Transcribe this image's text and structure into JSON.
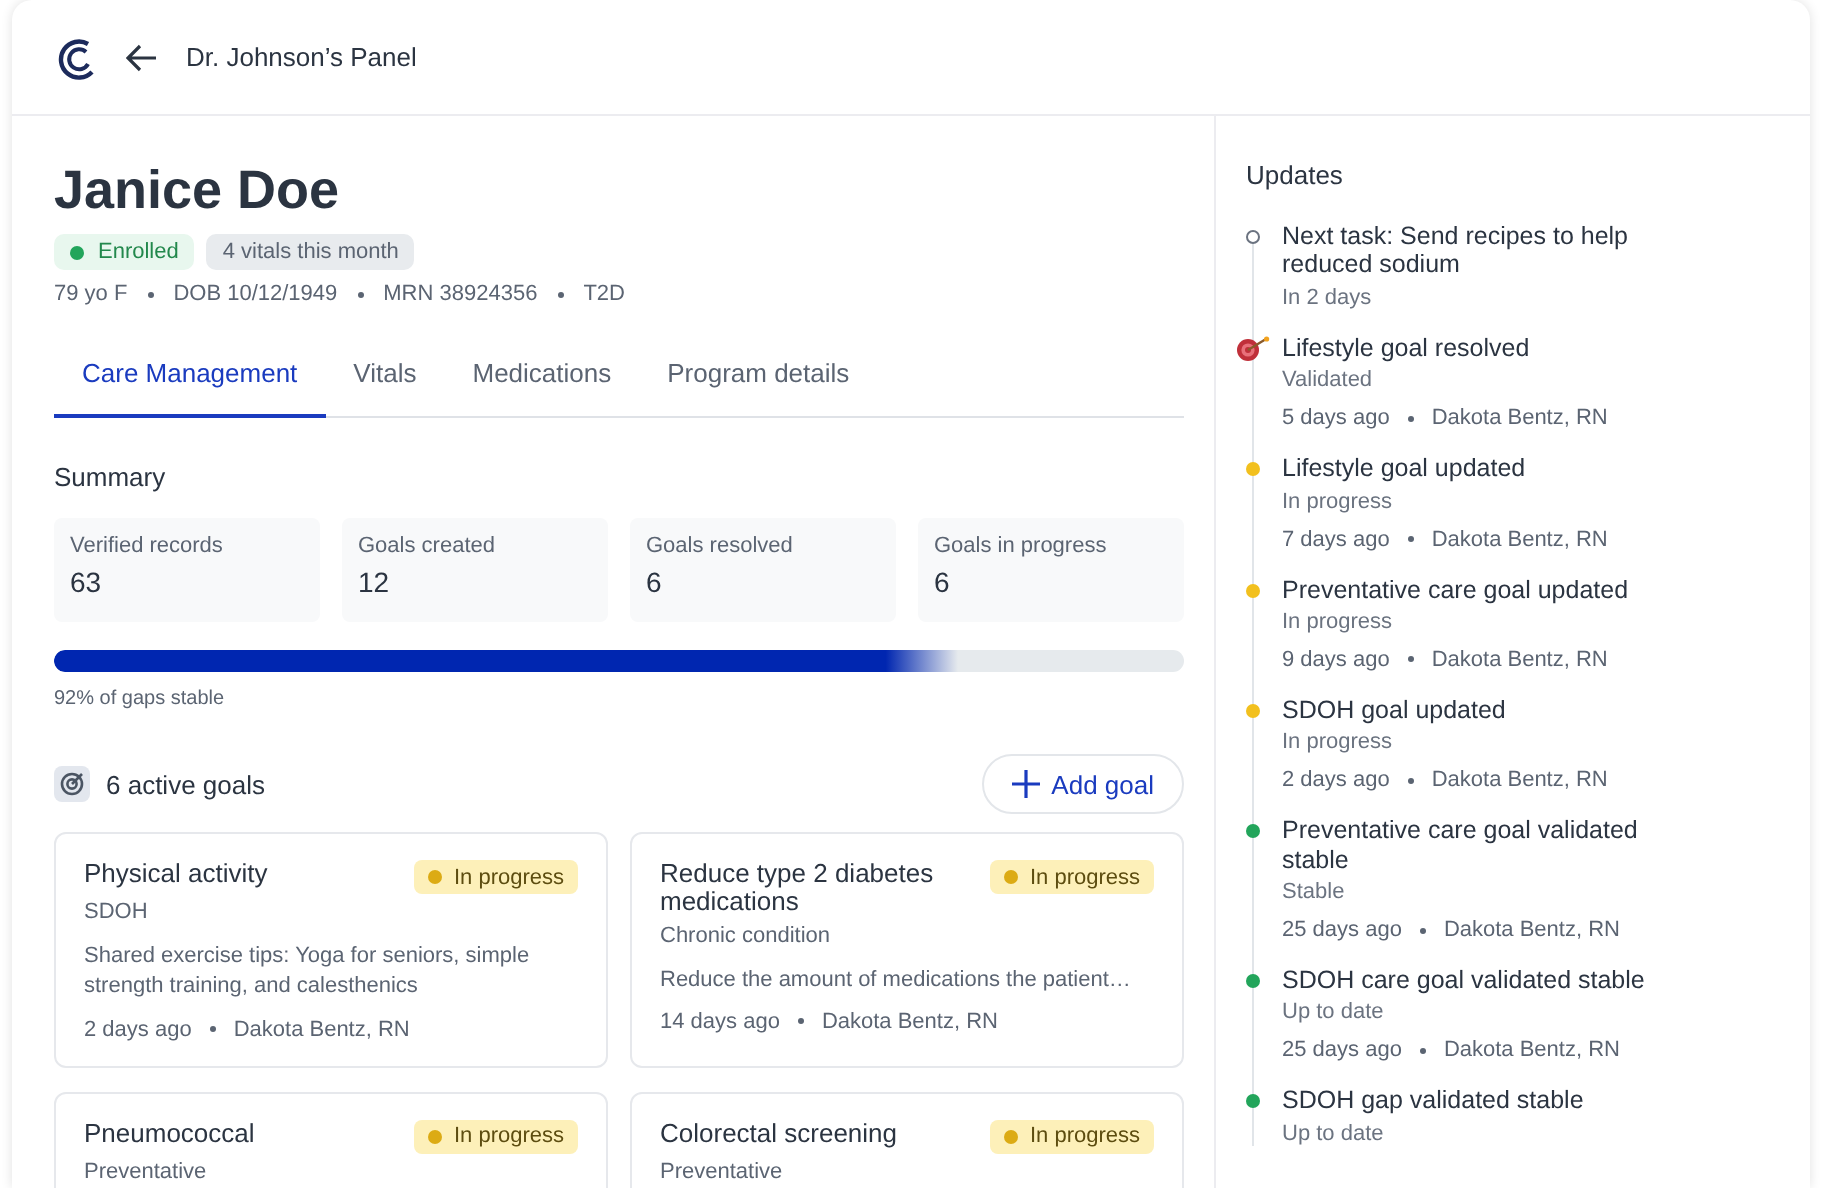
{
  "header": {
    "back_label": "Dr. Johnson’s Panel"
  },
  "patient": {
    "name": "Janice Doe",
    "badges": [
      {
        "kind": "status",
        "label": "Enrolled",
        "color": "#22a55b"
      },
      {
        "kind": "plain",
        "label": "4 vitals this month"
      }
    ],
    "details": [
      "79 yo F",
      "DOB 10/12/1949",
      "MRN 38924356",
      "T2D"
    ]
  },
  "tabs": [
    {
      "label": "Care Management",
      "selected": true
    },
    {
      "label": "Vitals",
      "selected": false
    },
    {
      "label": "Medications",
      "selected": false
    },
    {
      "label": "Program details",
      "selected": false
    }
  ],
  "summary": {
    "title": "Summary",
    "stats": [
      {
        "label": "Verified records",
        "value": "63"
      },
      {
        "label": "Goals created",
        "value": "12"
      },
      {
        "label": "Goals resolved",
        "value": "6"
      },
      {
        "label": "Goals in progress",
        "value": "6"
      }
    ],
    "progress": {
      "level": 0.8,
      "reading": "92% of gaps stable"
    }
  },
  "goals": {
    "title": "6 active goals",
    "add_button": "Add goal",
    "items": [
      {
        "title": "Physical activity",
        "category": "SDOH",
        "status": "In progress",
        "description": "Shared exercise tips: Yoga for seniors, simple strength training, and calesthenics",
        "time": "2 days ago",
        "author": "Dakota Bentz, RN"
      },
      {
        "title": "Reduce type 2 diabetes medications",
        "category": "Chronic condition",
        "status": "In progress",
        "description": "Reduce the amount of medications the patient…",
        "time": "14 days ago",
        "author": "Dakota Bentz, RN"
      },
      {
        "title": "Pneumococcal",
        "category": "Preventative",
        "status": "In progress"
      },
      {
        "title": "Colorectal screening",
        "category": "Preventative",
        "status": "In progress"
      }
    ]
  },
  "updates": {
    "title": "Updates",
    "items": [
      {
        "kind": "pending",
        "title": "Next task: Send recipes to help reduced sodium",
        "status": "In 2 days"
      },
      {
        "kind": "target",
        "title": "Lifestyle goal resolved",
        "status": "Validated",
        "time": "5 days ago",
        "author": "Dakota Bentz, RN"
      },
      {
        "kind": "dot",
        "color": "#f2c01e",
        "title": "Lifestyle goal updated",
        "status": "In progress",
        "time": "7 days ago",
        "author": "Dakota Bentz, RN"
      },
      {
        "kind": "dot",
        "color": "#f2c01e",
        "title": "Preventative care goal updated",
        "status": "In progress",
        "time": "9 days ago",
        "author": "Dakota Bentz, RN"
      },
      {
        "kind": "dot",
        "color": "#f2c01e",
        "title": "SDOH goal updated",
        "status": "In progress",
        "time": "2 days ago",
        "author": "Dakota Bentz, RN"
      },
      {
        "kind": "dot",
        "color": "#22a55b",
        "title": "Preventative care goal validated stable",
        "status": "Stable",
        "time": "25 days ago",
        "author": "Dakota Bentz, RN"
      },
      {
        "kind": "dot",
        "color": "#22a55b",
        "title": "SDOH care goal validated stable",
        "status": "Up to date",
        "time": "25 days ago",
        "author": "Dakota Bentz, RN"
      },
      {
        "kind": "dot",
        "color": "#22a55b",
        "title": "SDOH gap validated stable",
        "status": "Up to date"
      }
    ]
  }
}
